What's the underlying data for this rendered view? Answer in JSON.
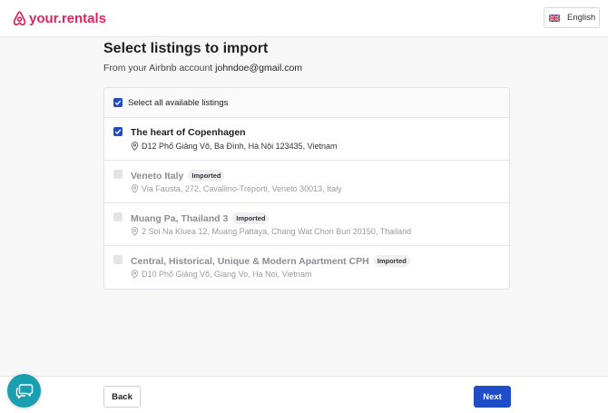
{
  "header": {
    "logo_text": "your.rentals",
    "language_label": "English",
    "brand_color": "#e0245e"
  },
  "main": {
    "title": "Select listings to import",
    "subtitle_prefix": "From your Airbnb account",
    "account_email": "johndoe@gmail.com",
    "select_all_label": "Select all available listings",
    "select_all_checked": true,
    "listings": [
      {
        "title": "The heart of Copenhagen",
        "address": "D12 Phố Giảng Võ, Ba Đình, Hà Nội 123435, Vietnam",
        "checked": true,
        "imported": false,
        "badge": ""
      },
      {
        "title": "Veneto Italy",
        "address": "Via Fausta, 272, Cavallino-Treporti, Veneto 30013, Italy",
        "checked": false,
        "imported": true,
        "badge": "Imported"
      },
      {
        "title": "Muang Pa, Thailand 3",
        "address": "2 Soi Na Kluea 12, Muang Pattaya, Chang Wat Chon Buri 20150, Thailand",
        "checked": false,
        "imported": true,
        "badge": "Imported"
      },
      {
        "title": "Central, Historical, Unique & Modern Apartment CPH",
        "address": "D10 Phố Giảng Võ, Giang Vo, Ha Noi, Vietnam",
        "checked": false,
        "imported": true,
        "badge": "Imported"
      }
    ]
  },
  "footer": {
    "back_label": "Back",
    "next_label": "Next",
    "accent_color": "#1f4cc7"
  },
  "icons": {
    "logo": "airbnb-logo-icon",
    "flag": "uk-flag-icon",
    "checkbox": "checkmark-icon",
    "pin": "map-pin-icon",
    "chat": "chat-bubble-icon"
  }
}
